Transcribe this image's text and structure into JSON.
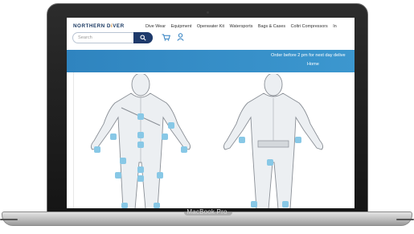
{
  "device": {
    "label": "MacBook Pro"
  },
  "site": {
    "logo": {
      "part1": "NORTHERN D",
      "accent": "i",
      "part2": "VER"
    },
    "nav": [
      "Dive Wear",
      "Equipment",
      "Openwater Kit",
      "Watersports",
      "Bags & Cases",
      "Coltri Compressors",
      "In"
    ],
    "search": {
      "placeholder": "Search"
    },
    "banner": {
      "text": "Order before 2 pm for next day delive",
      "home": "Home"
    },
    "colors": {
      "navy": "#1e3a6b",
      "banner": "#3c97cf",
      "marker": "#88c8e6",
      "suit": "#e9ecef"
    }
  }
}
